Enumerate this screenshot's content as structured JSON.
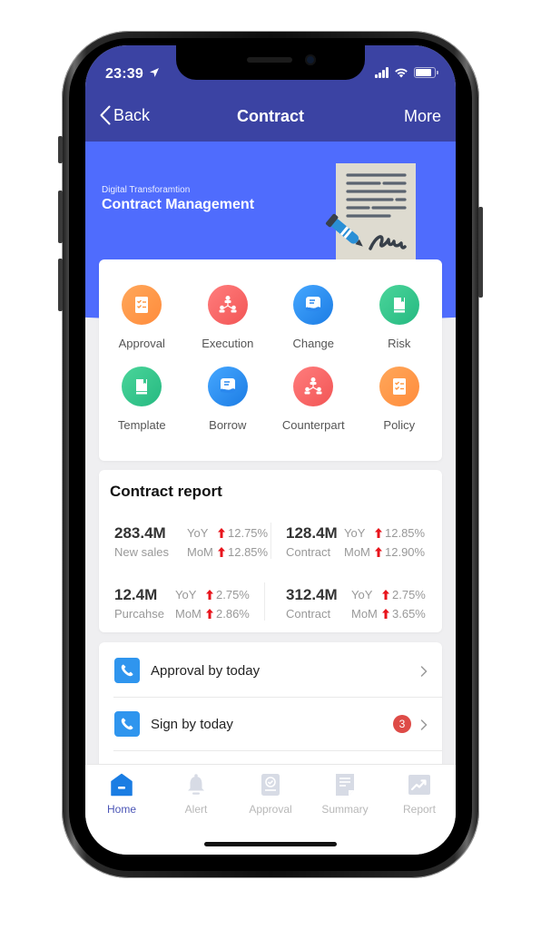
{
  "status_bar": {
    "time": "23:39",
    "location_icon": "location-arrow-icon",
    "signal_icon": "cellular-signal-icon",
    "wifi_icon": "wifi-icon",
    "battery_icon": "battery-icon",
    "battery_level": 0.85
  },
  "nav": {
    "back_label": "Back",
    "title": "Contract",
    "more_label": "More"
  },
  "banner": {
    "subtitle": "Digital Transforamtion",
    "title": "Contract Management",
    "illustration": "contract-signing-icon"
  },
  "quick_actions": [
    {
      "label": "Approval",
      "icon": "checklist-icon",
      "color_from": "#ffa75a",
      "color_to": "#ff8c3c"
    },
    {
      "label": "Execution",
      "icon": "org-chart-icon",
      "color_from": "#ff7d7d",
      "color_to": "#f25555"
    },
    {
      "label": "Change",
      "icon": "hand-document-icon",
      "color_from": "#45a7ff",
      "color_to": "#1c7ce4"
    },
    {
      "label": "Risk",
      "icon": "book-icon",
      "color_from": "#4ad59a",
      "color_to": "#26b981"
    },
    {
      "label": "Template",
      "icon": "book-icon",
      "color_from": "#4ad59a",
      "color_to": "#26b981"
    },
    {
      "label": "Borrow",
      "icon": "hand-document-icon",
      "color_from": "#45a7ff",
      "color_to": "#1c7ce4"
    },
    {
      "label": "Counterpart",
      "icon": "org-chart-icon",
      "color_from": "#ff7d7d",
      "color_to": "#f25555"
    },
    {
      "label": "Policy",
      "icon": "checklist-icon",
      "color_from": "#ffa75a",
      "color_to": "#ff8c3c"
    }
  ],
  "report": {
    "title": "Contract report",
    "up_color": "#e8141c",
    "metrics": [
      {
        "value": "283.4M",
        "label": "New sales",
        "yoy_label": "YoY",
        "yoy": "12.75%",
        "mom_label": "MoM",
        "mom": "12.85%"
      },
      {
        "value": "128.4M",
        "label": "Contract",
        "yoy_label": "YoY",
        "yoy": "12.85%",
        "mom_label": "MoM",
        "mom": "12.90%"
      },
      {
        "value": "12.4M",
        "label": "Purcahse",
        "yoy_label": "YoY",
        "yoy": "2.75%",
        "mom_label": "MoM",
        "mom": "2.86%"
      },
      {
        "value": "312.4M",
        "label": "Contract",
        "yoy_label": "YoY",
        "yoy": "2.75%",
        "mom_label": "MoM",
        "mom": "3.65%"
      }
    ]
  },
  "todo_list": [
    {
      "label": "Approval by today",
      "icon": "phone-icon",
      "badge": null
    },
    {
      "label": "Sign by today",
      "icon": "phone-icon",
      "badge": "3"
    }
  ],
  "tabbar": {
    "active_color": "#1a7de3",
    "inactive_color": "#d7dbe5",
    "items": [
      {
        "label": "Home",
        "icon": "home-icon",
        "active": true
      },
      {
        "label": "Alert",
        "icon": "bell-icon",
        "active": false
      },
      {
        "label": "Approval",
        "icon": "approval-badge-icon",
        "active": false
      },
      {
        "label": "Summary",
        "icon": "document-icon",
        "active": false
      },
      {
        "label": "Report",
        "icon": "trend-chart-icon",
        "active": false
      }
    ]
  }
}
